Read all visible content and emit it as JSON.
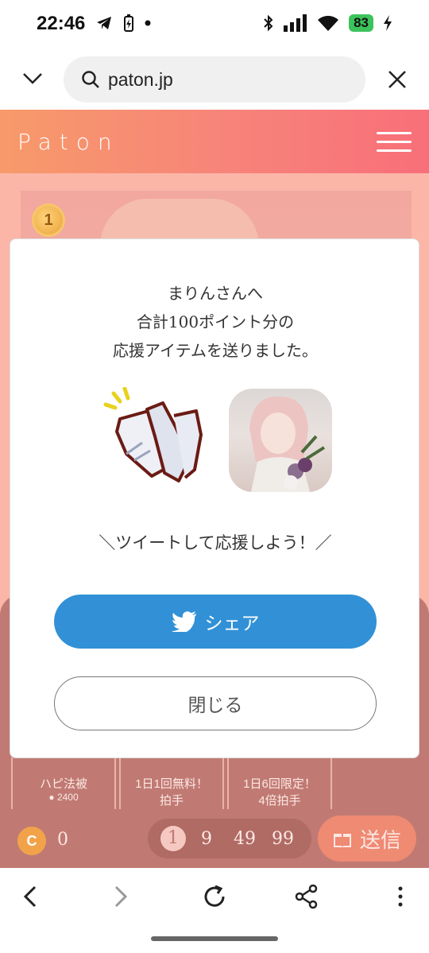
{
  "status_bar": {
    "time": "22:46",
    "battery": "83"
  },
  "url_bar": {
    "url": "paton.jp"
  },
  "site": {
    "logo": "Paton",
    "medal_rank": "1"
  },
  "modal": {
    "message_line1": "まりんさんへ",
    "message_line2": "合計100ポイント分の",
    "message_line3": "応援アイテムを送りました。",
    "tweet_prompt": "＼ツイートして応援しよう！／",
    "share_label": "シェア",
    "close_label": "閉じる"
  },
  "items": [
    {
      "label": "ハピ法被",
      "price": "2400"
    },
    {
      "label": "1日1回無料！",
      "sub": "拍手"
    },
    {
      "label": "1日6回限定！",
      "sub": "4倍拍手"
    }
  ],
  "bottom_bar": {
    "coin_count": "0",
    "quantities": [
      "1",
      "9",
      "49",
      "99"
    ],
    "send_label": "送信"
  },
  "colors": {
    "header_gradient_start": "#f79a6a",
    "header_gradient_end": "#f86f79",
    "share_button": "#3291d6",
    "overlay_bg": "#fbb6a8"
  }
}
